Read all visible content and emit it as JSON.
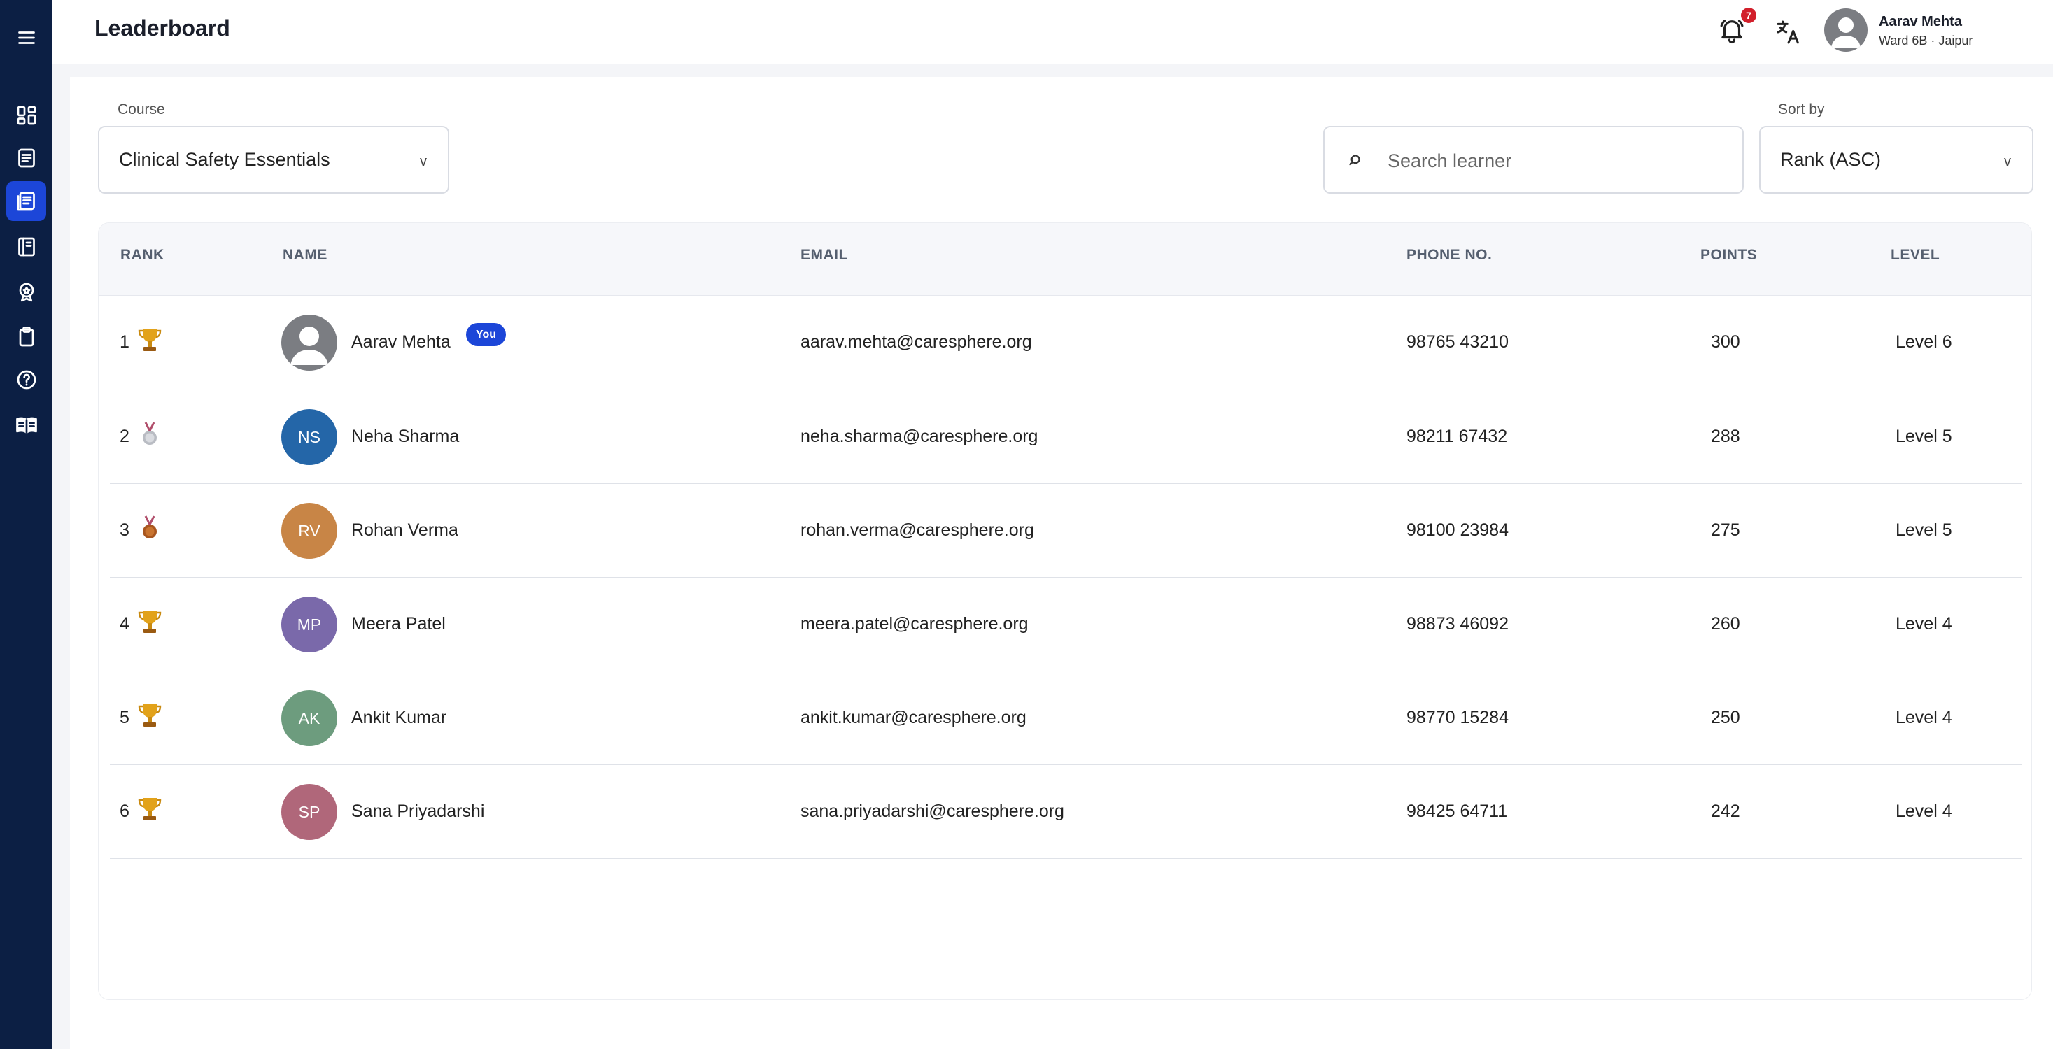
{
  "header": {
    "title": "Leaderboard",
    "notification_count": "7",
    "user_name": "Aarav Mehta",
    "user_subtitle": "Ward 6B · Jaipur"
  },
  "sidebar": {
    "items": [
      {
        "icon": "menu-icon"
      },
      {
        "icon": "dashboard-icon"
      },
      {
        "icon": "notes-icon"
      },
      {
        "icon": "leaderboard-icon",
        "active": true
      },
      {
        "icon": "book-icon"
      },
      {
        "icon": "badge-icon"
      },
      {
        "icon": "clipboard-icon"
      },
      {
        "icon": "help-icon"
      },
      {
        "icon": "open-book-icon"
      }
    ]
  },
  "filters": {
    "course_label": "Course",
    "course_value": "Clinical Safety Essentials",
    "search_placeholder": "Search learner",
    "sort_label": "Sort by",
    "sort_value": "Rank (ASC)"
  },
  "table": {
    "columns": [
      "RANK",
      "NAME",
      "EMAIL",
      "PHONE NO.",
      "POINTS",
      "LEVEL"
    ],
    "you_label": "You",
    "rows": [
      {
        "rank": "1",
        "medal": "trophy",
        "initials": "",
        "avatar_color": "#7b7d82",
        "name": "Aarav Mehta",
        "you": true,
        "email": "aarav.mehta@caresphere.org",
        "phone": "98765 43210",
        "points": "300",
        "level": "Level 6"
      },
      {
        "rank": "2",
        "medal": "silver",
        "initials": "NS",
        "avatar_color": "#2466a8",
        "name": "Neha Sharma",
        "you": false,
        "email": "neha.sharma@caresphere.org",
        "phone": "98211 67432",
        "points": "288",
        "level": "Level 5"
      },
      {
        "rank": "3",
        "medal": "bronze",
        "initials": "RV",
        "avatar_color": "#c88546",
        "name": "Rohan Verma",
        "you": false,
        "email": "rohan.verma@caresphere.org",
        "phone": "98100 23984",
        "points": "275",
        "level": "Level 5"
      },
      {
        "rank": "4",
        "medal": "trophy",
        "initials": "MP",
        "avatar_color": "#7a69aa",
        "name": "Meera Patel",
        "you": false,
        "email": "meera.patel@caresphere.org",
        "phone": "98873 46092",
        "points": "260",
        "level": "Level 4"
      },
      {
        "rank": "5",
        "medal": "trophy",
        "initials": "AK",
        "avatar_color": "#6d9c7e",
        "name": "Ankit Kumar",
        "you": false,
        "email": "ankit.kumar@caresphere.org",
        "phone": "98770 15284",
        "points": "250",
        "level": "Level 4"
      },
      {
        "rank": "6",
        "medal": "trophy",
        "initials": "SP",
        "avatar_color": "#b0677a",
        "name": "Sana Priyadarshi",
        "you": false,
        "email": "sana.priyadarshi@caresphere.org",
        "phone": "98425 64711",
        "points": "242",
        "level": "Level 4"
      }
    ]
  }
}
